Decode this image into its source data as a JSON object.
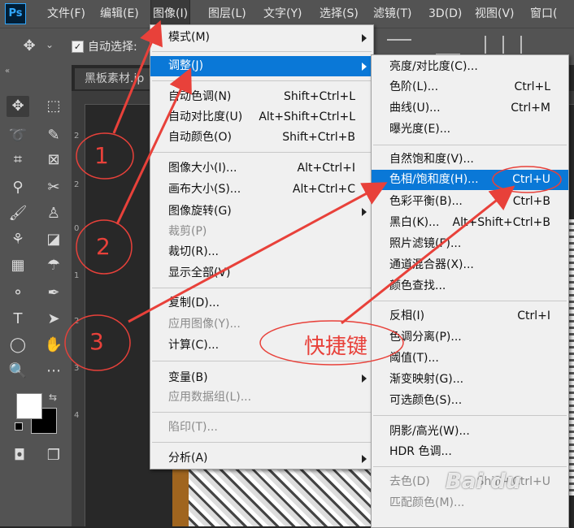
{
  "app": {
    "logo": "Ps"
  },
  "menubar": {
    "items": [
      "文件(F)",
      "编辑(E)",
      "图像(I)",
      "图层(L)",
      "文字(Y)",
      "选择(S)",
      "滤镜(T)",
      "3D(D)",
      "视图(V)",
      "窗口("
    ],
    "active_index": 2
  },
  "options_bar": {
    "auto_select_label": "自动选择:",
    "auto_select_checked": true
  },
  "document": {
    "tab_title": "黑板素材.jp",
    "ruler_numbers": [
      "2",
      "2",
      "0",
      "1",
      "2",
      "3",
      "4"
    ]
  },
  "image_menu": {
    "items": [
      {
        "label": "模式(M)",
        "shortcut": "",
        "submenu": true,
        "disabled": false
      },
      {
        "label": "调整(J)",
        "shortcut": "",
        "submenu": true,
        "disabled": false,
        "highlighted": true
      },
      {
        "label": "自动色调(N)",
        "shortcut": "Shift+Ctrl+L"
      },
      {
        "label": "自动对比度(U)",
        "shortcut": "Alt+Shift+Ctrl+L"
      },
      {
        "label": "自动颜色(O)",
        "shortcut": "Shift+Ctrl+B"
      },
      {
        "label": "图像大小(I)...",
        "shortcut": "Alt+Ctrl+I"
      },
      {
        "label": "画布大小(S)...",
        "shortcut": "Alt+Ctrl+C"
      },
      {
        "label": "图像旋转(G)",
        "shortcut": "",
        "submenu": true
      },
      {
        "label": "裁剪(P)",
        "shortcut": "",
        "disabled": true
      },
      {
        "label": "裁切(R)...",
        "shortcut": ""
      },
      {
        "label": "显示全部(V)",
        "shortcut": ""
      },
      {
        "label": "复制(D)...",
        "shortcut": ""
      },
      {
        "label": "应用图像(Y)...",
        "shortcut": "",
        "disabled": true
      },
      {
        "label": "计算(C)...",
        "shortcut": ""
      },
      {
        "label": "变量(B)",
        "shortcut": "",
        "submenu": true
      },
      {
        "label": "应用数据组(L)...",
        "shortcut": "",
        "disabled": true
      },
      {
        "label": "陷印(T)...",
        "shortcut": "",
        "disabled": true
      },
      {
        "label": "分析(A)",
        "shortcut": "",
        "submenu": true
      }
    ]
  },
  "adjust_menu": {
    "items": [
      {
        "label": "亮度/对比度(C)...",
        "shortcut": ""
      },
      {
        "label": "色阶(L)...",
        "shortcut": "Ctrl+L"
      },
      {
        "label": "曲线(U)...",
        "shortcut": "Ctrl+M"
      },
      {
        "label": "曝光度(E)...",
        "shortcut": ""
      },
      {
        "label": "自然饱和度(V)...",
        "shortcut": ""
      },
      {
        "label": "色相/饱和度(H)...",
        "shortcut": "Ctrl+U",
        "highlighted": true
      },
      {
        "label": "色彩平衡(B)...",
        "shortcut": "Ctrl+B"
      },
      {
        "label": "黑白(K)...",
        "shortcut": "Alt+Shift+Ctrl+B"
      },
      {
        "label": "照片滤镜(F)...",
        "shortcut": ""
      },
      {
        "label": "通道混合器(X)...",
        "shortcut": ""
      },
      {
        "label": "颜色查找...",
        "shortcut": ""
      },
      {
        "label": "反相(I)",
        "shortcut": "Ctrl+I"
      },
      {
        "label": "色调分离(P)...",
        "shortcut": ""
      },
      {
        "label": "阈值(T)...",
        "shortcut": ""
      },
      {
        "label": "渐变映射(G)...",
        "shortcut": ""
      },
      {
        "label": "可选颜色(S)...",
        "shortcut": ""
      },
      {
        "label": "阴影/高光(W)...",
        "shortcut": ""
      },
      {
        "label": "HDR 色调...",
        "shortcut": ""
      },
      {
        "label": "去色(D)",
        "shortcut": "Shift+Ctrl+U",
        "disabled": true
      },
      {
        "label": "匹配颜色(M)...",
        "shortcut": "",
        "disabled": true
      }
    ]
  },
  "annotations": {
    "step1": "1",
    "step2": "2",
    "step3": "3",
    "shortcut_label": "快捷键",
    "color": "#e8413a"
  },
  "watermark": "Bai du"
}
